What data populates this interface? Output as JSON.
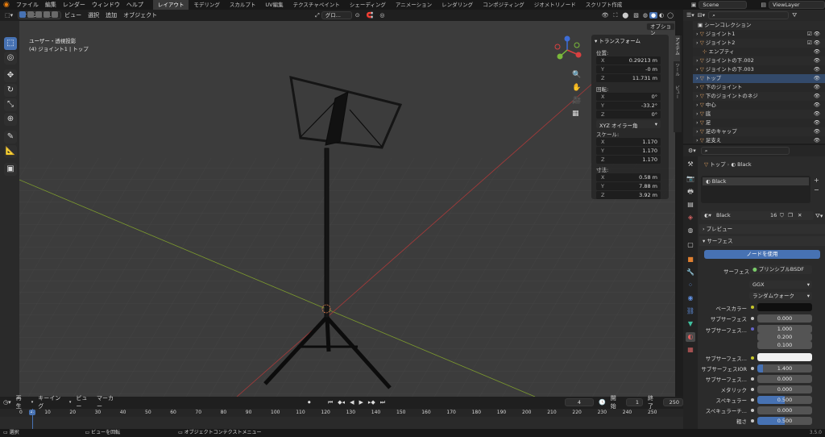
{
  "menubar": {
    "items": [
      "ファイル",
      "編集",
      "レンダー",
      "ウィンドウ",
      "ヘルプ"
    ],
    "workspaces": [
      "レイアウト",
      "モデリング",
      "スカルプト",
      "UV編集",
      "テクスチャペイント",
      "シェーディング",
      "アニメーション",
      "レンダリング",
      "コンポジティング",
      "ジオメトリノード",
      "スクリプト作成"
    ],
    "active_workspace": "レイアウト",
    "scene": "Scene",
    "view_layer": "ViewLayer"
  },
  "viewport_header": {
    "mode": "オブジェク...",
    "menus": [
      "ビュー",
      "選択",
      "追加",
      "オブジェクト"
    ],
    "orientation": "グロ...",
    "options": "オプション"
  },
  "viewport": {
    "overlay_line1": "ユーザー・透視投影",
    "overlay_line2": "(4) ジョイント1 | トップ",
    "gizmo_axes": [
      "X",
      "Y",
      "Z"
    ]
  },
  "n_panel": {
    "title": "トランスフォーム",
    "location_label": "位置:",
    "location": [
      {
        "axis": "X",
        "value": "0.29213 m"
      },
      {
        "axis": "Y",
        "value": "-0 m"
      },
      {
        "axis": "Z",
        "value": "11.731 m"
      }
    ],
    "rotation_label": "回転:",
    "rotation": [
      {
        "axis": "X",
        "value": "0°"
      },
      {
        "axis": "Y",
        "value": "-33.2°"
      },
      {
        "axis": "Z",
        "value": "0°"
      }
    ],
    "rotation_mode": "XYZ オイラー角",
    "scale_label": "スケール:",
    "scale": [
      {
        "axis": "X",
        "value": "1.170"
      },
      {
        "axis": "Y",
        "value": "1.170"
      },
      {
        "axis": "Z",
        "value": "1.170"
      }
    ],
    "dimensions_label": "寸法:",
    "dimensions": [
      {
        "axis": "X",
        "value": "0.58 m"
      },
      {
        "axis": "Y",
        "value": "7.88 m"
      },
      {
        "axis": "Z",
        "value": "3.92 m"
      }
    ],
    "side_tabs": [
      "アイテム",
      "ツール",
      "ビュー"
    ]
  },
  "outliner": {
    "root": "シーンコレクション",
    "items": [
      {
        "name": "ジョイント1",
        "icon": "triangle-orange"
      },
      {
        "name": "ジョイント2",
        "icon": "triangle-orange"
      },
      {
        "name": "エンプティ",
        "icon": "empty-axes"
      },
      {
        "name": "ジョイントの下.002",
        "icon": "triangle-orange"
      },
      {
        "name": "ジョイントの下.003",
        "icon": "triangle-orange"
      },
      {
        "name": "トップ",
        "icon": "triangle-orange"
      },
      {
        "name": "下のジョイント",
        "icon": "triangle-orange"
      },
      {
        "name": "下のジョイントのネジ",
        "icon": "triangle-orange"
      },
      {
        "name": "中心",
        "icon": "triangle-orange"
      },
      {
        "name": "底",
        "icon": "triangle-orange"
      },
      {
        "name": "足",
        "icon": "triangle-orange"
      },
      {
        "name": "足のキャップ",
        "icon": "triangle-orange"
      },
      {
        "name": "足支え",
        "icon": "triangle-orange"
      }
    ]
  },
  "properties": {
    "breadcrumb_object": "トップ",
    "breadcrumb_material": "Black",
    "material_slot": "Black",
    "material_name": "Black",
    "users": "16",
    "preview_label": "プレビュー",
    "surface_label": "サーフェス",
    "use_nodes": "ノードを使用",
    "surface_field_label": "サーフェス",
    "surface_value": "プリンシプルBSDF",
    "distribution": "GGX",
    "subsurface_method": "ランダムウォーク",
    "rows": [
      {
        "label": "ベースカラー",
        "value": "",
        "type": "color-dark"
      },
      {
        "label": "サブサーフェス",
        "value": "0.000",
        "type": "slider"
      },
      {
        "label": "サブサーフェス...",
        "value": "1.000",
        "type": "vector"
      },
      {
        "label": "",
        "value": "0.200",
        "type": "vector"
      },
      {
        "label": "",
        "value": "0.100",
        "type": "vector"
      },
      {
        "label": "サブサーフェス...",
        "value": "",
        "type": "color-white"
      },
      {
        "label": "サブサーフェスIOR",
        "value": "1.400",
        "type": "slider-small"
      },
      {
        "label": "サブサーフェス...",
        "value": "0.000",
        "type": "slider"
      },
      {
        "label": "メタリック",
        "value": "0.000",
        "type": "slider"
      },
      {
        "label": "スペキュラー",
        "value": "0.500",
        "type": "slider-blue"
      },
      {
        "label": "スペキュラーチ...",
        "value": "0.000",
        "type": "slider"
      },
      {
        "label": "粗さ",
        "value": "0.500",
        "type": "slider-blue"
      }
    ]
  },
  "timeline": {
    "menus": [
      "再生",
      "キーイング",
      "ビュー",
      "マーカー"
    ],
    "current_frame": "4",
    "start_label": "開始",
    "start": "1",
    "end_label": "終了",
    "end": "250",
    "ticks": [
      "0",
      "4",
      "10",
      "20",
      "30",
      "40",
      "50",
      "60",
      "70",
      "80",
      "90",
      "100",
      "110",
      "120",
      "130",
      "140",
      "150",
      "160",
      "170",
      "180",
      "190",
      "200",
      "210",
      "220",
      "230",
      "240",
      "250"
    ]
  },
  "statusbar": {
    "select": "選択",
    "pan": "ビューを回転",
    "context": "オブジェクトコンテクストメニュー",
    "version": "3.5.0"
  }
}
